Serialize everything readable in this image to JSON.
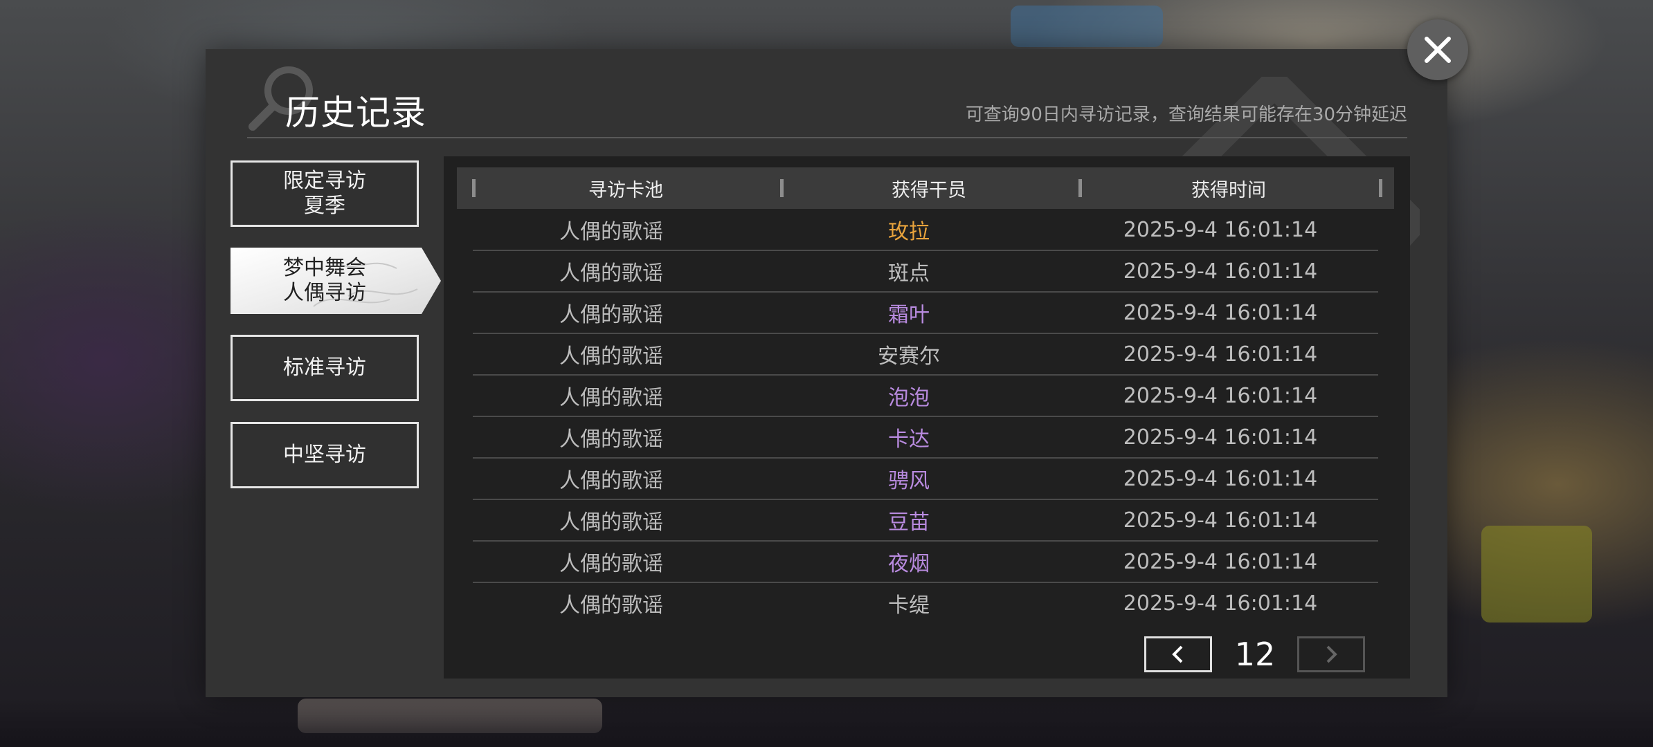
{
  "dialog": {
    "title": "历史记录",
    "notice": "可查询90日内寻访记录，查询结果可能存在30分钟延迟"
  },
  "tabs": [
    {
      "line1": "限定寻访",
      "line2": "夏季",
      "active": false
    },
    {
      "line1": "梦中舞会",
      "line2": "人偶寻访",
      "active": true
    },
    {
      "line1": "标准寻访",
      "line2": "",
      "active": false
    },
    {
      "line1": "中坚寻访",
      "line2": "",
      "active": false
    }
  ],
  "table": {
    "headers": [
      "寻访卡池",
      "获得干员",
      "获得时间"
    ],
    "rows": [
      {
        "pool": "人偶的歌谣",
        "operator": "玫拉",
        "time": "2025-9-4 16:01:14",
        "color": "#e8a33c"
      },
      {
        "pool": "人偶的歌谣",
        "operator": "斑点",
        "time": "2025-9-4 16:01:14",
        "color": "#bdbdbd"
      },
      {
        "pool": "人偶的歌谣",
        "operator": "霜叶",
        "time": "2025-9-4 16:01:14",
        "color": "#b98be0"
      },
      {
        "pool": "人偶的歌谣",
        "operator": "安赛尔",
        "time": "2025-9-4 16:01:14",
        "color": "#bdbdbd"
      },
      {
        "pool": "人偶的歌谣",
        "operator": "泡泡",
        "time": "2025-9-4 16:01:14",
        "color": "#b98be0"
      },
      {
        "pool": "人偶的歌谣",
        "operator": "卡达",
        "time": "2025-9-4 16:01:14",
        "color": "#b98be0"
      },
      {
        "pool": "人偶的歌谣",
        "operator": "骋风",
        "time": "2025-9-4 16:01:14",
        "color": "#b98be0"
      },
      {
        "pool": "人偶的歌谣",
        "operator": "豆苗",
        "time": "2025-9-4 16:01:14",
        "color": "#b98be0"
      },
      {
        "pool": "人偶的歌谣",
        "operator": "夜烟",
        "time": "2025-9-4 16:01:14",
        "color": "#b98be0"
      },
      {
        "pool": "人偶的歌谣",
        "operator": "卡缇",
        "time": "2025-9-4 16:01:14",
        "color": "#bdbdbd"
      }
    ]
  },
  "pager": {
    "page": "12",
    "prev_icon": "chevron-left-icon",
    "next_icon": "chevron-right-icon"
  },
  "close_icon": "close-icon",
  "colors": {
    "panel_bg": "#333333",
    "table_bg": "#202020",
    "header_bg": "#3b3b3b",
    "gold_rarity": "#e8a33c",
    "purple_rarity": "#b98be0",
    "normal_text": "#bdbdbd"
  }
}
